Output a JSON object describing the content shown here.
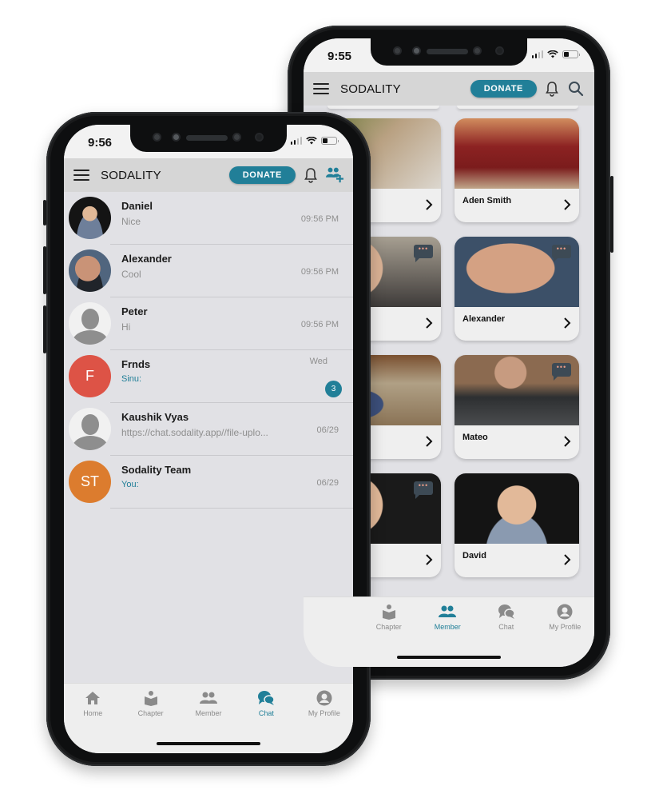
{
  "back_phone": {
    "status": {
      "time": "9:55"
    },
    "appbar": {
      "title": "SODALITY",
      "donate_label": "DONATE",
      "icons": [
        "menu-icon",
        "bell-icon",
        "search-icon"
      ]
    },
    "members": [
      {
        "name": "",
        "has_chat": false
      },
      {
        "name": "Aden Smith",
        "has_chat": false
      },
      {
        "name": "",
        "has_chat": true
      },
      {
        "name": "Alexander",
        "has_chat": true
      },
      {
        "name": "",
        "has_chat": false
      },
      {
        "name": "Mateo",
        "has_chat": true
      },
      {
        "name": "",
        "has_chat": true
      },
      {
        "name": "David",
        "has_chat": false
      }
    ],
    "chat_bubble_glyph": "•••",
    "nav": [
      {
        "label": "Chapter",
        "icon": "chapter-icon",
        "active": false
      },
      {
        "label": "Member",
        "icon": "member-icon",
        "active": true
      },
      {
        "label": "Chat",
        "icon": "chat-icon",
        "active": false
      },
      {
        "label": "My Profile",
        "icon": "profile-icon",
        "active": false
      }
    ]
  },
  "front_phone": {
    "status": {
      "time": "9:56"
    },
    "appbar": {
      "title": "SODALITY",
      "donate_label": "DONATE",
      "icons": [
        "menu-icon",
        "bell-icon",
        "add-group-icon"
      ]
    },
    "chats": [
      {
        "name": "Daniel",
        "message": "Nice",
        "time": "09:56 PM",
        "avatar": "photo",
        "initials": ""
      },
      {
        "name": "Alexander",
        "message": "Cool",
        "time": "09:56 PM",
        "avatar": "photo",
        "initials": ""
      },
      {
        "name": "Peter",
        "message": "Hi",
        "time": "09:56 PM",
        "avatar": "default",
        "initials": ""
      },
      {
        "name": "Frnds",
        "message": "Sinu:",
        "time": "Wed",
        "avatar": "initials",
        "initials": "F",
        "avatar_color": "#dd5346",
        "unread": "3"
      },
      {
        "name": "Kaushik Vyas",
        "message": "https://chat.sodality.app//file-uplo...",
        "time": "06/29",
        "avatar": "default",
        "initials": ""
      },
      {
        "name": "Sodality Team",
        "message": "You:",
        "time": "06/29",
        "avatar": "initials",
        "initials": "ST",
        "avatar_color": "#dc7c2e"
      }
    ],
    "nav": [
      {
        "label": "Home",
        "icon": "home-icon",
        "active": false
      },
      {
        "label": "Chapter",
        "icon": "chapter-icon",
        "active": false
      },
      {
        "label": "Member",
        "icon": "member-icon",
        "active": false
      },
      {
        "label": "Chat",
        "icon": "chat-icon",
        "active": true
      },
      {
        "label": "My Profile",
        "icon": "profile-icon",
        "active": false
      }
    ]
  },
  "colors": {
    "accent": "#217f98",
    "nav_inactive": "#8a8a8a",
    "appbar_bg": "#d6d6d6",
    "screen_bg": "#e1e1e5"
  }
}
